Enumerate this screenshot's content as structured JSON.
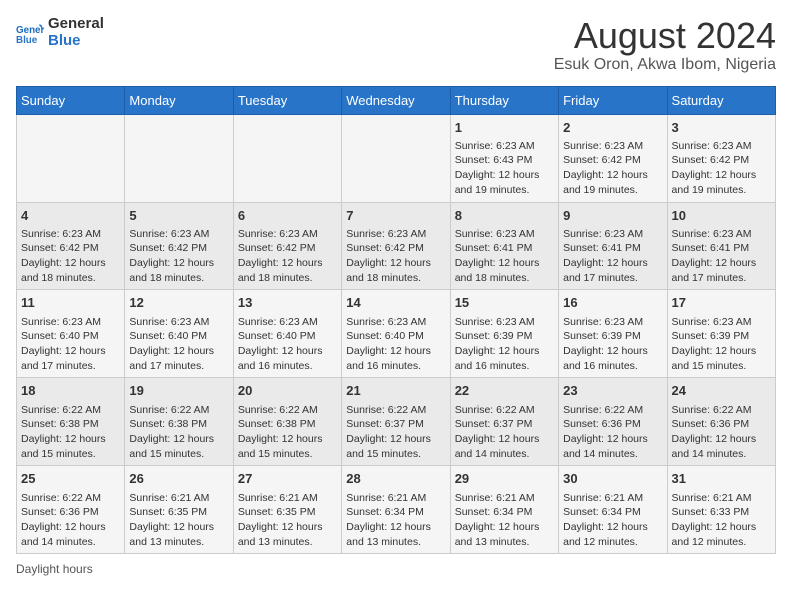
{
  "logo": {
    "text_general": "General",
    "text_blue": "Blue"
  },
  "header": {
    "title": "August 2024",
    "subtitle": "Esuk Oron, Akwa Ibom, Nigeria"
  },
  "weekdays": [
    "Sunday",
    "Monday",
    "Tuesday",
    "Wednesday",
    "Thursday",
    "Friday",
    "Saturday"
  ],
  "weeks": [
    [
      {
        "day": "",
        "info": ""
      },
      {
        "day": "",
        "info": ""
      },
      {
        "day": "",
        "info": ""
      },
      {
        "day": "",
        "info": ""
      },
      {
        "day": "1",
        "info": "Sunrise: 6:23 AM\nSunset: 6:43 PM\nDaylight: 12 hours and 19 minutes."
      },
      {
        "day": "2",
        "info": "Sunrise: 6:23 AM\nSunset: 6:42 PM\nDaylight: 12 hours and 19 minutes."
      },
      {
        "day": "3",
        "info": "Sunrise: 6:23 AM\nSunset: 6:42 PM\nDaylight: 12 hours and 19 minutes."
      }
    ],
    [
      {
        "day": "4",
        "info": "Sunrise: 6:23 AM\nSunset: 6:42 PM\nDaylight: 12 hours and 18 minutes."
      },
      {
        "day": "5",
        "info": "Sunrise: 6:23 AM\nSunset: 6:42 PM\nDaylight: 12 hours and 18 minutes."
      },
      {
        "day": "6",
        "info": "Sunrise: 6:23 AM\nSunset: 6:42 PM\nDaylight: 12 hours and 18 minutes."
      },
      {
        "day": "7",
        "info": "Sunrise: 6:23 AM\nSunset: 6:42 PM\nDaylight: 12 hours and 18 minutes."
      },
      {
        "day": "8",
        "info": "Sunrise: 6:23 AM\nSunset: 6:41 PM\nDaylight: 12 hours and 18 minutes."
      },
      {
        "day": "9",
        "info": "Sunrise: 6:23 AM\nSunset: 6:41 PM\nDaylight: 12 hours and 17 minutes."
      },
      {
        "day": "10",
        "info": "Sunrise: 6:23 AM\nSunset: 6:41 PM\nDaylight: 12 hours and 17 minutes."
      }
    ],
    [
      {
        "day": "11",
        "info": "Sunrise: 6:23 AM\nSunset: 6:40 PM\nDaylight: 12 hours and 17 minutes."
      },
      {
        "day": "12",
        "info": "Sunrise: 6:23 AM\nSunset: 6:40 PM\nDaylight: 12 hours and 17 minutes."
      },
      {
        "day": "13",
        "info": "Sunrise: 6:23 AM\nSunset: 6:40 PM\nDaylight: 12 hours and 16 minutes."
      },
      {
        "day": "14",
        "info": "Sunrise: 6:23 AM\nSunset: 6:40 PM\nDaylight: 12 hours and 16 minutes."
      },
      {
        "day": "15",
        "info": "Sunrise: 6:23 AM\nSunset: 6:39 PM\nDaylight: 12 hours and 16 minutes."
      },
      {
        "day": "16",
        "info": "Sunrise: 6:23 AM\nSunset: 6:39 PM\nDaylight: 12 hours and 16 minutes."
      },
      {
        "day": "17",
        "info": "Sunrise: 6:23 AM\nSunset: 6:39 PM\nDaylight: 12 hours and 15 minutes."
      }
    ],
    [
      {
        "day": "18",
        "info": "Sunrise: 6:22 AM\nSunset: 6:38 PM\nDaylight: 12 hours and 15 minutes."
      },
      {
        "day": "19",
        "info": "Sunrise: 6:22 AM\nSunset: 6:38 PM\nDaylight: 12 hours and 15 minutes."
      },
      {
        "day": "20",
        "info": "Sunrise: 6:22 AM\nSunset: 6:38 PM\nDaylight: 12 hours and 15 minutes."
      },
      {
        "day": "21",
        "info": "Sunrise: 6:22 AM\nSunset: 6:37 PM\nDaylight: 12 hours and 15 minutes."
      },
      {
        "day": "22",
        "info": "Sunrise: 6:22 AM\nSunset: 6:37 PM\nDaylight: 12 hours and 14 minutes."
      },
      {
        "day": "23",
        "info": "Sunrise: 6:22 AM\nSunset: 6:36 PM\nDaylight: 12 hours and 14 minutes."
      },
      {
        "day": "24",
        "info": "Sunrise: 6:22 AM\nSunset: 6:36 PM\nDaylight: 12 hours and 14 minutes."
      }
    ],
    [
      {
        "day": "25",
        "info": "Sunrise: 6:22 AM\nSunset: 6:36 PM\nDaylight: 12 hours and 14 minutes."
      },
      {
        "day": "26",
        "info": "Sunrise: 6:21 AM\nSunset: 6:35 PM\nDaylight: 12 hours and 13 minutes."
      },
      {
        "day": "27",
        "info": "Sunrise: 6:21 AM\nSunset: 6:35 PM\nDaylight: 12 hours and 13 minutes."
      },
      {
        "day": "28",
        "info": "Sunrise: 6:21 AM\nSunset: 6:34 PM\nDaylight: 12 hours and 13 minutes."
      },
      {
        "day": "29",
        "info": "Sunrise: 6:21 AM\nSunset: 6:34 PM\nDaylight: 12 hours and 13 minutes."
      },
      {
        "day": "30",
        "info": "Sunrise: 6:21 AM\nSunset: 6:34 PM\nDaylight: 12 hours and 12 minutes."
      },
      {
        "day": "31",
        "info": "Sunrise: 6:21 AM\nSunset: 6:33 PM\nDaylight: 12 hours and 12 minutes."
      }
    ]
  ],
  "footer": {
    "label": "Daylight hours"
  }
}
